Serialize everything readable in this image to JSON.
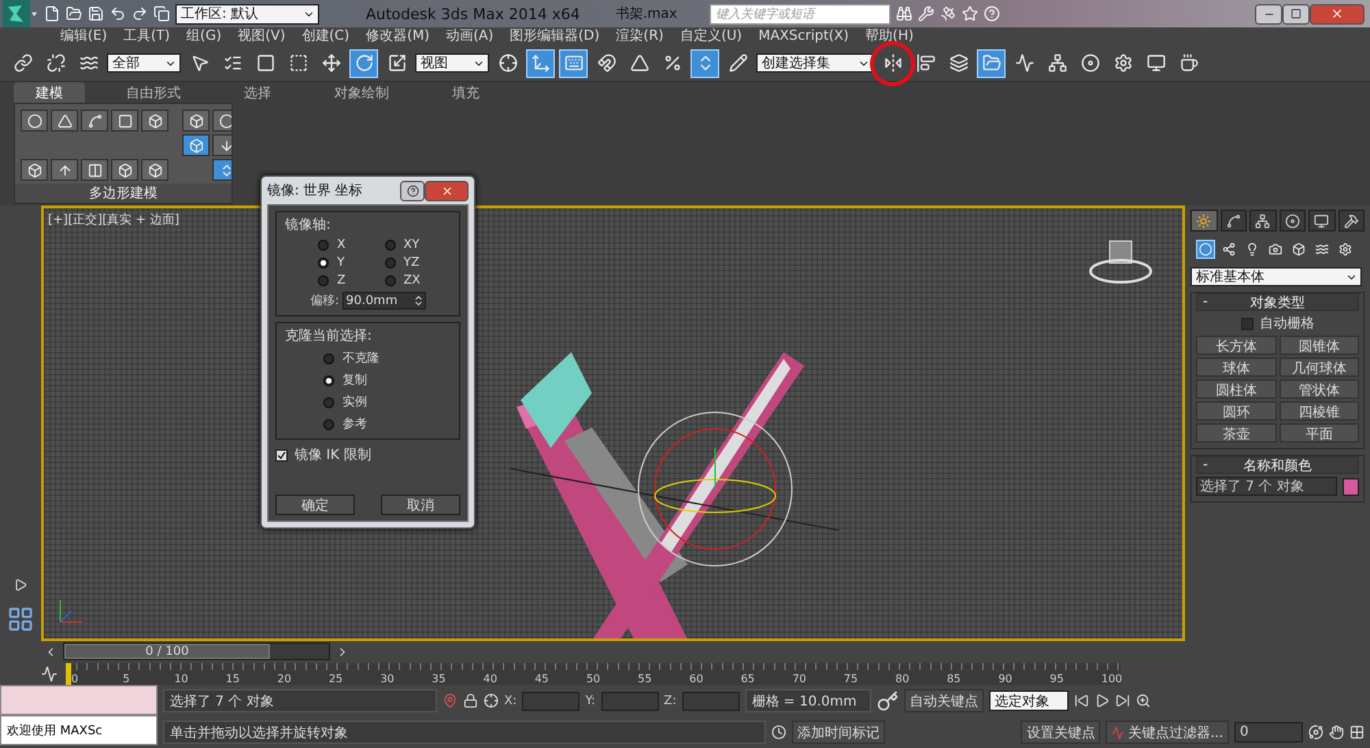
{
  "title_bar": {
    "workspace": "工作区: 默认",
    "app_title": "Autodesk 3ds Max  2014 x64",
    "file_name": "书架.max",
    "search": {
      "placeholder": "键入关键字或短语"
    }
  },
  "menu": [
    "编辑(E)",
    "工具(T)",
    "组(G)",
    "视图(V)",
    "创建(C)",
    "修改器(M)",
    "动画(A)",
    "图形编辑器(D)",
    "渲染(R)",
    "自定义(U)",
    "MAXScript(X)",
    "帮助(H)"
  ],
  "toolbar": [
    {
      "kind": "tool",
      "selected": false,
      "circled": false
    },
    {
      "kind": "tool",
      "selected": false,
      "circled": false
    },
    {
      "kind": "tool",
      "selected": false,
      "circled": false
    },
    {
      "kind": "dropdown",
      "value": "全部"
    },
    {
      "kind": "tool",
      "selected": false,
      "circled": false
    },
    {
      "kind": "tool",
      "selected": false,
      "circled": false
    },
    {
      "kind": "tool",
      "selected": false,
      "circled": false
    },
    {
      "kind": "tool",
      "selected": false,
      "circled": false
    },
    {
      "kind": "tool",
      "selected": false,
      "circled": false
    },
    {
      "kind": "tool",
      "selected": true,
      "circled": false
    },
    {
      "kind": "tool",
      "selected": false,
      "circled": false
    },
    {
      "kind": "dropdown",
      "value": "视图"
    },
    {
      "kind": "tool",
      "selected": false,
      "circled": false
    },
    {
      "kind": "tool",
      "selected": true,
      "circled": false
    },
    {
      "kind": "tool",
      "selected": true,
      "circled": false
    },
    {
      "kind": "tool",
      "selected": false,
      "circled": false
    },
    {
      "kind": "tool",
      "selected": false,
      "circled": false
    },
    {
      "kind": "tool",
      "selected": false,
      "circled": false
    },
    {
      "kind": "tool",
      "selected": true,
      "circled": false
    },
    {
      "kind": "tool",
      "selected": false,
      "circled": false
    },
    {
      "kind": "dropdown",
      "value": "创建选择集"
    },
    {
      "kind": "tool",
      "selected": false,
      "circled": true
    },
    {
      "kind": "tool",
      "selected": false,
      "circled": false
    },
    {
      "kind": "tool",
      "selected": false,
      "circled": false
    },
    {
      "kind": "tool",
      "selected": true,
      "circled": false
    },
    {
      "kind": "tool",
      "selected": false,
      "circled": false
    },
    {
      "kind": "tool",
      "selected": false,
      "circled": false
    },
    {
      "kind": "tool",
      "selected": false,
      "circled": false
    },
    {
      "kind": "tool",
      "selected": false,
      "circled": false
    },
    {
      "kind": "tool",
      "selected": false,
      "circled": false
    },
    {
      "kind": "tool",
      "selected": false,
      "circled": false
    }
  ],
  "ribbon": {
    "tabs": [
      {
        "label": "建模",
        "selected": true
      },
      {
        "label": "自由形式",
        "selected": false
      },
      {
        "label": "选择",
        "selected": false
      },
      {
        "label": "对象绘制",
        "selected": false
      },
      {
        "label": "填充",
        "selected": false
      }
    ],
    "tools": [
      {
        "selected": false
      },
      {
        "selected": false
      },
      {
        "selected": false
      },
      {
        "selected": false
      },
      {
        "selected": false
      },
      {
        "selected": false
      },
      {
        "selected": false
      },
      {
        "selected": false
      },
      {
        "selected": false
      },
      {
        "selected": false
      },
      {
        "selected": false
      },
      {
        "selected": true
      },
      {
        "selected": false
      },
      {
        "selected": false
      },
      {
        "selected": true
      }
    ],
    "panel_label": "多边形建模"
  },
  "viewport": {
    "label": "[+][正交][真实 + 边面]",
    "active": true
  },
  "dialog": {
    "title": "镜像: 世界 坐标",
    "mirror_axis": {
      "label": "镜像轴:",
      "options": [
        {
          "label": "X",
          "selected": false
        },
        {
          "label": "XY",
          "selected": false
        },
        {
          "label": "Y",
          "selected": true
        },
        {
          "label": "YZ",
          "selected": false
        },
        {
          "label": "Z",
          "selected": false
        },
        {
          "label": "ZX",
          "selected": false
        }
      ]
    },
    "offset": {
      "label": "偏移:",
      "value": "90.0mm"
    },
    "clone": {
      "label": "克隆当前选择:",
      "options": [
        {
          "label": "不克隆",
          "selected": false
        },
        {
          "label": "复制",
          "selected": true
        },
        {
          "label": "实例",
          "selected": false
        },
        {
          "label": "参考",
          "selected": false
        }
      ]
    },
    "ik": {
      "label": "镜像 IK 限制",
      "checked": true
    },
    "buttons": [
      "确定",
      "取消"
    ]
  },
  "command_panel": {
    "tabs": [
      {
        "selected": true
      },
      {
        "selected": false
      },
      {
        "selected": false
      },
      {
        "selected": false
      },
      {
        "selected": false
      },
      {
        "selected": false
      }
    ],
    "categories": [
      {
        "selected": true
      },
      {
        "selected": false
      },
      {
        "selected": false
      },
      {
        "selected": false
      },
      {
        "selected": false
      },
      {
        "selected": false
      },
      {
        "selected": false
      }
    ],
    "subcategory": "标准基本体",
    "object_type": {
      "toggle": "-",
      "title": "对象类型",
      "autogrid": {
        "label": "自动栅格",
        "checked": false
      },
      "buttons": [
        "长方体",
        "圆锥体",
        "球体",
        "几何球体",
        "圆柱体",
        "管状体",
        "圆环",
        "四棱锥",
        "茶壶",
        "平面"
      ]
    },
    "name_color": {
      "toggle": "-",
      "title": "名称和颜色",
      "name": "选择了 7 个 对象",
      "color": "#d8589c"
    }
  },
  "timeline": {
    "position": "0 / 100",
    "ticks": [
      "0",
      "5",
      "10",
      "15",
      "20",
      "25",
      "30",
      "35",
      "40",
      "45",
      "50",
      "55",
      "60",
      "65",
      "70",
      "75",
      "80",
      "85",
      "90",
      "95",
      "100"
    ]
  },
  "status_bar": {
    "listener": "欢迎使用 MAXSc",
    "selection": "选择了 7 个 对象",
    "prompt": "单击并拖动以选择并旋转对象",
    "coords": [
      "X:",
      "Y:",
      "Z:"
    ],
    "grid": "栅格 = 10.0mm",
    "add_time_tag": "添加时间标记",
    "auto_key": "自动关键点",
    "set_key": "设置关键点",
    "key_mode": "选定对象",
    "key_filters": "关键点过滤器...",
    "frame": "0"
  }
}
